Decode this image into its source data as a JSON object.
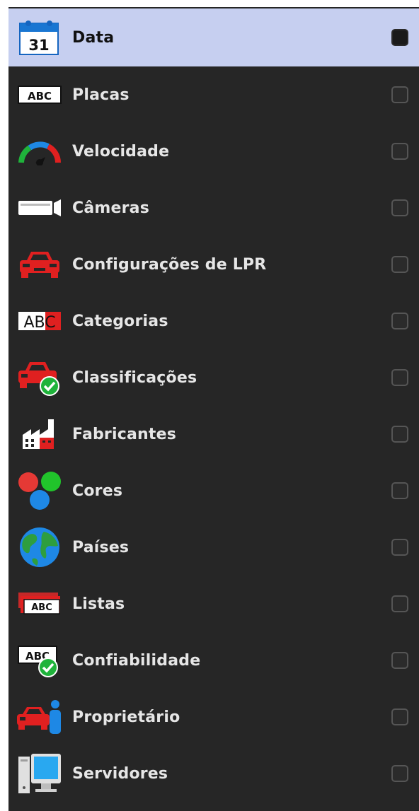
{
  "filter_panel": {
    "items": [
      {
        "label": "Data",
        "icon": "calendar-icon",
        "icon_text": "31",
        "selected": true,
        "checked": true
      },
      {
        "label": "Placas",
        "icon": "license-plate-icon",
        "icon_text": "ABC",
        "checked": false
      },
      {
        "label": "Velocidade",
        "icon": "speedometer-icon",
        "checked": false
      },
      {
        "label": "Câmeras",
        "icon": "camera-icon",
        "checked": false
      },
      {
        "label": "Configurações de LPR",
        "icon": "car-icon",
        "checked": false
      },
      {
        "label": "Categorias",
        "icon": "category-plate-icon",
        "icon_text": "ABC",
        "checked": false
      },
      {
        "label": "Classificações",
        "icon": "car-check-icon",
        "checked": false
      },
      {
        "label": "Fabricantes",
        "icon": "factory-icon",
        "checked": false
      },
      {
        "label": "Cores",
        "icon": "color-dots-icon",
        "checked": false
      },
      {
        "label": "Países",
        "icon": "globe-icon",
        "checked": false
      },
      {
        "label": "Listas",
        "icon": "plate-list-icon",
        "icon_text": "ABC",
        "checked": false
      },
      {
        "label": "Confiabilidade",
        "icon": "plate-check-icon",
        "icon_text": "ABC",
        "checked": false
      },
      {
        "label": "Proprietário",
        "icon": "car-owner-icon",
        "checked": false
      },
      {
        "label": "Servidores",
        "icon": "server-icon",
        "checked": false
      }
    ]
  },
  "colors": {
    "panel_bg": "#262626",
    "selected_bg": "#c6cff0",
    "label": "#e6e6e6",
    "red": "#e02020",
    "green": "#1fb33b",
    "blue": "#1e88e5"
  }
}
